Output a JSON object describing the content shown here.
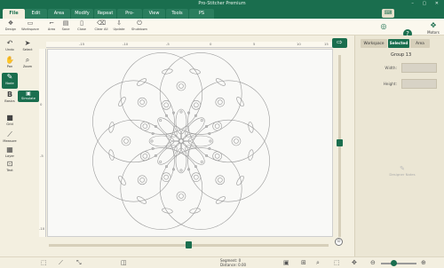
{
  "window": {
    "title": "Pro-Stitcher Premium",
    "controls": "–  ▢  ✕"
  },
  "menu": {
    "tabs": [
      {
        "label": "File",
        "active": true
      },
      {
        "label": "Edit"
      },
      {
        "label": "Area"
      },
      {
        "label": "Modify"
      },
      {
        "label": "Repeat"
      },
      {
        "label": "Pro-Stitcher"
      },
      {
        "label": "View"
      },
      {
        "label": "Tools"
      },
      {
        "label": "PS Patterns"
      }
    ]
  },
  "ribbon": {
    "buttons": [
      {
        "label": "Design",
        "icon": "design-icon"
      },
      {
        "label": "Workspace",
        "icon": "workspace-icon"
      },
      {
        "label": "Area",
        "icon": "area-icon"
      },
      {
        "label": "Save",
        "icon": "save-icon"
      },
      {
        "label": "Close",
        "icon": "close-file-icon"
      },
      {
        "label": "Clear All",
        "icon": "clear-all-icon"
      },
      {
        "label": "Update",
        "icon": "update-icon"
      },
      {
        "label": "Shutdown",
        "icon": "shutdown-icon"
      }
    ]
  },
  "right_icons": {
    "motors_label": "Motors"
  },
  "tools": [
    {
      "label": "Undo",
      "icon": "undo-icon"
    },
    {
      "label": "Select",
      "icon": "select-icon"
    },
    {
      "label": "Pan",
      "icon": "pan-icon"
    },
    {
      "label": "Zoom",
      "icon": "zoom-icon"
    },
    {
      "label": "Node",
      "icon": "node-icon"
    },
    {
      "label": "Basics",
      "icon": "basics-icon"
    },
    {
      "label": "Simulate",
      "icon": "simulate-icon"
    },
    {
      "label": "Grid",
      "icon": "grid-icon"
    },
    {
      "label": "Measure",
      "icon": "measure-icon"
    },
    {
      "label": "Layer",
      "icon": "layer-icon"
    },
    {
      "label": "Text",
      "icon": "text-icon"
    }
  ],
  "ruler": {
    "top_ticks": [
      "-15",
      "-10",
      "-5",
      "0",
      "5",
      "10",
      "15"
    ],
    "left_ticks": [
      "0",
      "-5",
      "-10"
    ]
  },
  "panel": {
    "tabs": [
      "Workspace",
      "Selected",
      "Area"
    ],
    "active_tab": "Selected",
    "group_title": "Group 13",
    "width_label": "Width:",
    "height_label": "Height:",
    "designer_notes": "Designer Notes"
  },
  "status": {
    "segment_label": "Segment:",
    "segment_value": "0",
    "distance_label": "Distance:",
    "distance_value": "0.00"
  },
  "zoom": {
    "level": 0.35
  },
  "colors": {
    "brand": "#1a6e4e",
    "background": "#f3efe0",
    "canvas": "#f9f9f7"
  }
}
